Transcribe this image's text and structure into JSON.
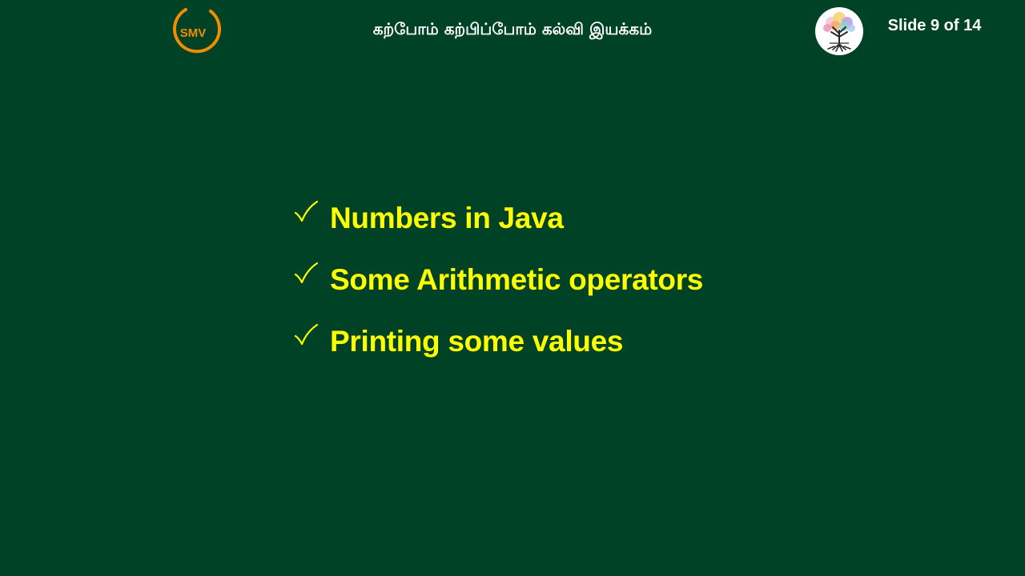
{
  "header": {
    "logo_left": {
      "icon": "smv-logo-icon",
      "text": "SMV",
      "ring_color": "#f28c00",
      "text_color": "#f28c00"
    },
    "title": "கற்போம் கற்பிப்போம் கல்வி இயக்கம்",
    "logo_right": {
      "icon": "tree-logo-icon"
    },
    "slide_number": "Slide 9 of 14"
  },
  "content": {
    "bullet_icon": "checkmark-icon",
    "bullets": [
      {
        "label": "Numbers in Java"
      },
      {
        "label": "Some Arithmetic operators"
      },
      {
        "label": "Printing some values"
      }
    ]
  },
  "colors": {
    "background": "#004225",
    "header_text": "#ffffff",
    "bullet_text": "#ffff00"
  }
}
